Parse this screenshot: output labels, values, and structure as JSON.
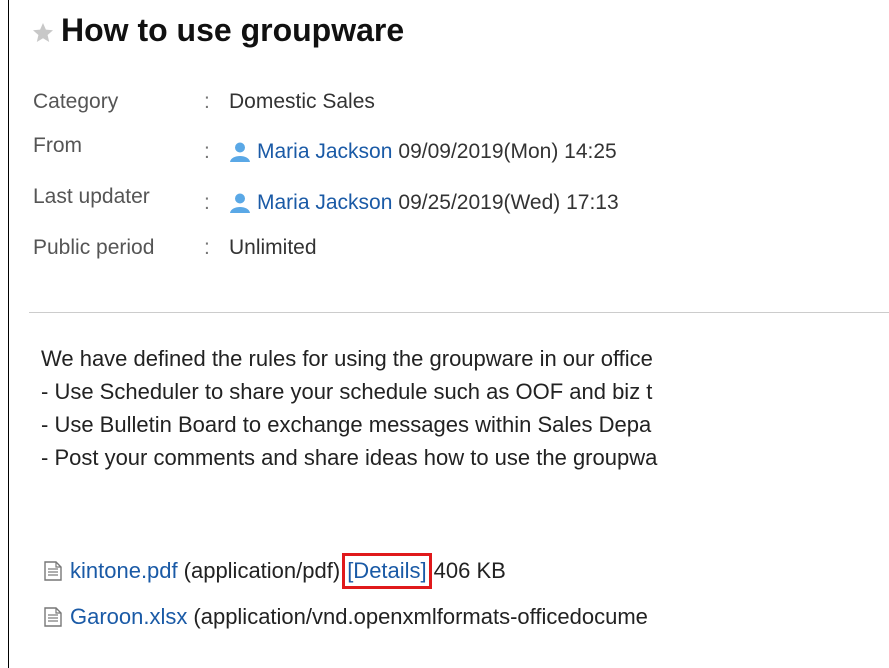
{
  "post": {
    "title": "How to use groupware",
    "category_label": "Category",
    "category_value": "Domestic Sales",
    "from_label": "From",
    "from_user": "Maria Jackson",
    "from_date": "09/09/2019(Mon) 14:25",
    "updater_label": "Last updater",
    "updater_user": "Maria Jackson",
    "updater_date": "09/25/2019(Wed) 17:13",
    "public_label": "Public period",
    "public_value": "Unlimited",
    "colon": ":"
  },
  "body": {
    "lines": [
      "We have defined the rules for using the groupware in our office",
      "- Use Scheduler to share your schedule such as OOF and biz t",
      "- Use Bulletin Board to exchange messages within Sales Depa",
      "- Post your comments and share ideas how to use the groupwa"
    ]
  },
  "attachments": [
    {
      "name": "kintone.pdf",
      "type": "(application/pdf)",
      "details": "[Details]",
      "size": "406 KB"
    },
    {
      "name": "Garoon.xlsx",
      "type": "(application/vnd.openxmlformats-officedocume"
    }
  ],
  "colors": {
    "link": "#1a5aa6",
    "highlight": "#e0191b"
  }
}
